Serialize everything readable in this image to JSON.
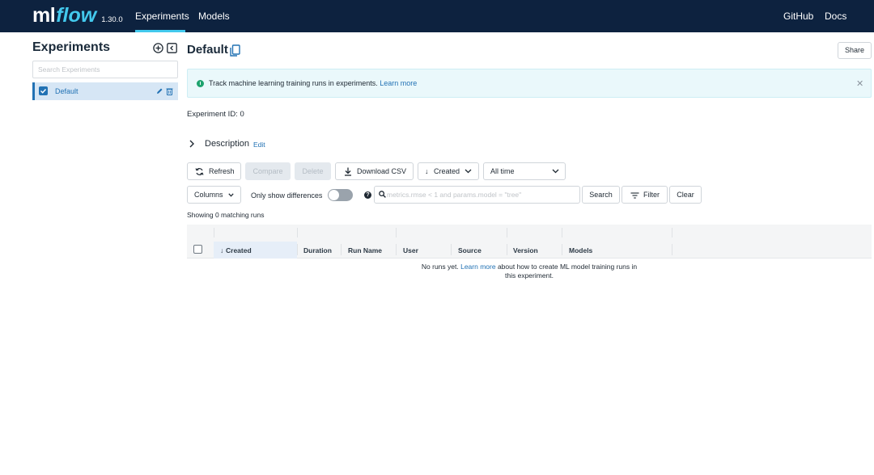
{
  "nav": {
    "logo_ml": "ml",
    "logo_flow": "flow",
    "version": "1.30.0",
    "links": [
      "Experiments",
      "Models"
    ],
    "right_links": [
      "GitHub",
      "Docs"
    ],
    "active": "Experiments",
    "accent_color": "#43c9ed",
    "bg_color": "#0d223f"
  },
  "sidebar": {
    "title": "Experiments",
    "search_placeholder": "Search Experiments",
    "experiments": [
      {
        "name": "Default",
        "checked": true
      }
    ]
  },
  "main": {
    "title": "Default",
    "share_label": "Share",
    "banner": {
      "text": "Track machine learning training runs in experiments.",
      "link": "Learn more"
    },
    "experiment_id_label": "Experiment ID:",
    "experiment_id": "0",
    "description_label": "Description",
    "description_edit": "Edit",
    "toolbar": {
      "refresh": "Refresh",
      "compare": "Compare",
      "delete": "Delete",
      "download_csv": "Download CSV",
      "sort": "Created",
      "time_range": "All time",
      "columns": "Columns",
      "only_show_differences": "Only show differences",
      "search_placeholder": "metrics.rmse < 1 and params.model = \"tree\"",
      "search": "Search",
      "filter": "Filter",
      "clear": "Clear"
    },
    "matching_runs": "Showing 0 matching runs",
    "table": {
      "columns": [
        "Created",
        "Duration",
        "Run Name",
        "User",
        "Source",
        "Version",
        "Models"
      ],
      "empty_pre": "No runs yet.",
      "empty_link": "Learn more",
      "empty_post": "about how to create ML model training runs in this experiment."
    }
  }
}
